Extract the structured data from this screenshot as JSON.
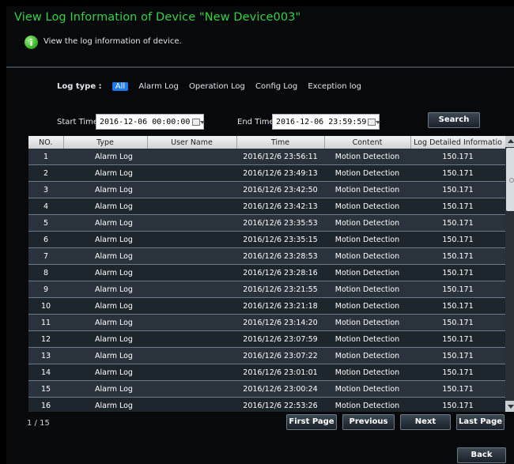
{
  "window": {
    "title": "View Log Information of Device \"New Device003\"",
    "subtitle": "View the log information of device."
  },
  "filters": {
    "log_type_label": "Log type :",
    "log_types": [
      "All",
      "Alarm Log",
      "Operation Log",
      "Config Log",
      "Exception log"
    ],
    "active_log_type": "All",
    "start_time_label": "Start Time",
    "start_time_value": "2016-12-06  00:00:00",
    "end_time_label": "End Time",
    "end_time_value": "2016-12-06  23:59:59",
    "search_label": "Search"
  },
  "table": {
    "columns": [
      "NO.",
      "Type",
      "User Name",
      "Time",
      "Content",
      "Log Detailed Informatio"
    ],
    "rows": [
      [
        "1",
        "Alarm Log",
        "",
        "2016/12/6 23:56:11",
        "Motion Detection",
        "150.171"
      ],
      [
        "2",
        "Alarm Log",
        "",
        "2016/12/6 23:49:13",
        "Motion Detection",
        "150.171"
      ],
      [
        "3",
        "Alarm Log",
        "",
        "2016/12/6 23:42:50",
        "Motion Detection",
        "150.171"
      ],
      [
        "4",
        "Alarm Log",
        "",
        "2016/12/6 23:42:13",
        "Motion Detection",
        "150.171"
      ],
      [
        "5",
        "Alarm Log",
        "",
        "2016/12/6 23:35:53",
        "Motion Detection",
        "150.171"
      ],
      [
        "6",
        "Alarm Log",
        "",
        "2016/12/6 23:35:15",
        "Motion Detection",
        "150.171"
      ],
      [
        "7",
        "Alarm Log",
        "",
        "2016/12/6 23:28:53",
        "Motion Detection",
        "150.171"
      ],
      [
        "8",
        "Alarm Log",
        "",
        "2016/12/6 23:28:16",
        "Motion Detection",
        "150.171"
      ],
      [
        "9",
        "Alarm Log",
        "",
        "2016/12/6 23:21:55",
        "Motion Detection",
        "150.171"
      ],
      [
        "10",
        "Alarm Log",
        "",
        "2016/12/6 23:21:18",
        "Motion Detection",
        "150.171"
      ],
      [
        "11",
        "Alarm Log",
        "",
        "2016/12/6 23:14:20",
        "Motion Detection",
        "150.171"
      ],
      [
        "12",
        "Alarm Log",
        "",
        "2016/12/6 23:07:59",
        "Motion Detection",
        "150.171"
      ],
      [
        "13",
        "Alarm Log",
        "",
        "2016/12/6 23:07:22",
        "Motion Detection",
        "150.171"
      ],
      [
        "14",
        "Alarm Log",
        "",
        "2016/12/6 23:01:01",
        "Motion Detection",
        "150.171"
      ],
      [
        "15",
        "Alarm Log",
        "",
        "2016/12/6 23:00:24",
        "Motion Detection",
        "150.171"
      ],
      [
        "16",
        "Alarm Log",
        "",
        "2016/12/6 22:53:26",
        "Motion Detection",
        "150.171"
      ]
    ]
  },
  "pagination": {
    "page_info": "1 / 15",
    "first_label": "First Page",
    "prev_label": "Previous",
    "next_label": "Next",
    "last_label": "Last Page"
  },
  "footer": {
    "back_label": "Back"
  },
  "colors": {
    "title": "#35d246",
    "active_tab": "#1f7ae8",
    "background": "#07090b"
  }
}
